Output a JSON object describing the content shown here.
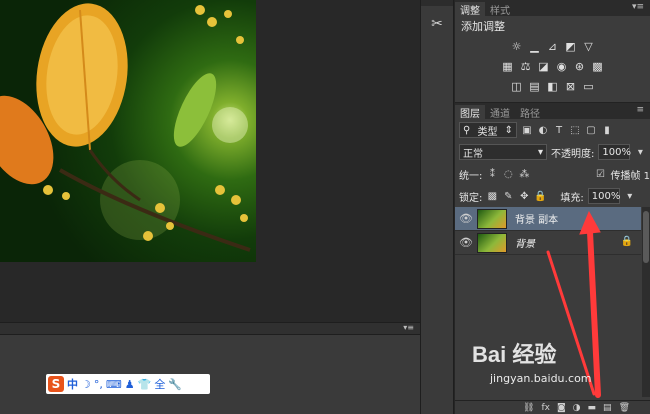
{
  "adjust_panel": {
    "tabs": [
      "调整",
      "样式"
    ],
    "title": "添加调整"
  },
  "layers_panel": {
    "tabs": [
      "图层",
      "通道",
      "路径"
    ],
    "filter_kind": "类型",
    "blend_mode": "正常",
    "opacity_label": "不透明度:",
    "opacity_value": "100%",
    "unify_label": "统一:",
    "propagate_label": "传播帧 1",
    "lock_label": "锁定:",
    "fill_label": "填充:",
    "fill_value": "100%",
    "layers": [
      {
        "name": "背景 副本",
        "selected": true
      },
      {
        "name": "背景",
        "selected": false,
        "locked": true
      }
    ]
  },
  "ime": {
    "logo": "S",
    "mode": "中"
  },
  "watermark": {
    "brand": "Bai 经验",
    "url": "jingyan.baidu.com"
  },
  "colors": {
    "panel_bg": "#3c3c3c",
    "selected_layer": "#5a6b80",
    "annotation_arrow": "#ff3a3a"
  }
}
